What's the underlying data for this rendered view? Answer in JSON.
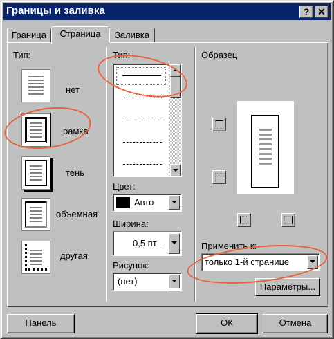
{
  "window": {
    "title": "Границы и заливка"
  },
  "titlebar_buttons": {
    "help": "?",
    "close": "✕"
  },
  "tabs": [
    {
      "label": "Граница"
    },
    {
      "label": "Страница"
    },
    {
      "label": "Заливка"
    }
  ],
  "type_group": {
    "label": "Тип:",
    "presets": [
      {
        "label": "нет"
      },
      {
        "label": "рамка"
      },
      {
        "label": "тень"
      },
      {
        "label": "объемная"
      },
      {
        "label": "другая"
      }
    ],
    "selected": "рамка"
  },
  "style_group": {
    "type_label": "Тип:",
    "color_label": "Цвет:",
    "color_value": "Авто",
    "color_swatch": "#000000",
    "width_label": "Ширина:",
    "width_value": "0,5 пт -",
    "art_label": "Рисунок:",
    "art_value": "(нет)"
  },
  "preview": {
    "label": "Образец",
    "apply_label": "Применить к:",
    "apply_value": "только 1-й странице",
    "options_button": "Параметры..."
  },
  "footer": {
    "panel_button": "Панель",
    "ok_button": "ОК",
    "cancel_button": "Отмена"
  },
  "colors": {
    "titlebar": "#08246b",
    "annotation": "#e8613a",
    "face": "#c0c0c0"
  }
}
